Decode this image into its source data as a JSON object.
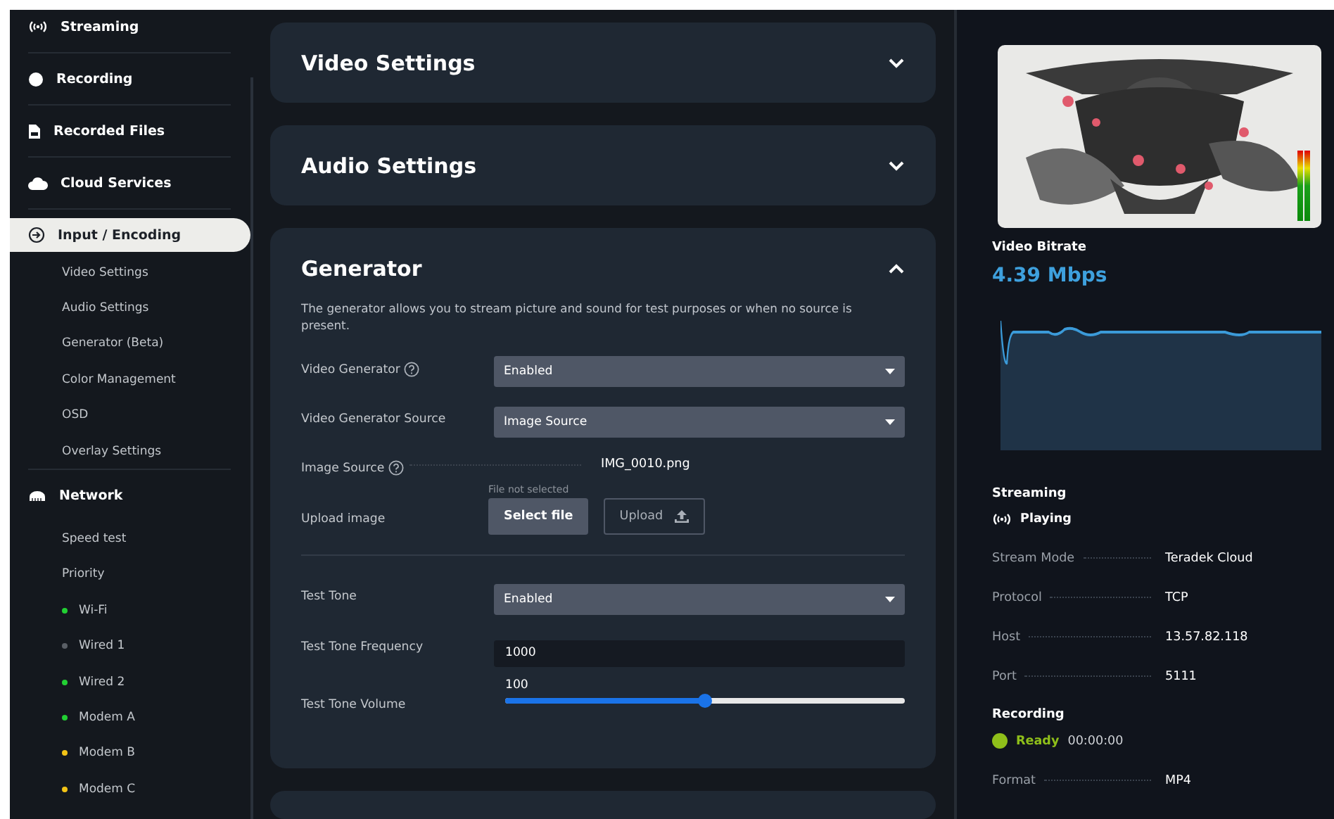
{
  "sidebar": {
    "items": [
      {
        "label": "Streaming",
        "selected": false
      },
      {
        "label": "Recording",
        "selected": false
      },
      {
        "label": "Recorded Files",
        "selected": false
      },
      {
        "label": "Cloud Services",
        "selected": false
      },
      {
        "label": "Input / Encoding",
        "selected": true,
        "children": [
          {
            "label": "Video Settings"
          },
          {
            "label": "Audio Settings"
          },
          {
            "label": "Generator (Beta)"
          },
          {
            "label": "Color Management"
          },
          {
            "label": "OSD"
          },
          {
            "label": "Overlay Settings"
          }
        ]
      },
      {
        "label": "Network",
        "selected": false,
        "children": [
          {
            "label": "Speed test"
          },
          {
            "label": "Priority"
          },
          {
            "label": "Wi-Fi",
            "color": "#22d033"
          },
          {
            "label": "Wired 1",
            "color": "#5a5f66"
          },
          {
            "label": "Wired 2",
            "color": "#22d033"
          },
          {
            "label": "Modem A",
            "color": "#22d033"
          },
          {
            "label": "Modem B",
            "color": "#f2c316"
          },
          {
            "label": "Modem C",
            "color": "#f2c316"
          }
        ]
      }
    ]
  },
  "cards": [
    {
      "title": "Video Settings",
      "expanded": false
    },
    {
      "title": "Audio Settings",
      "expanded": false
    },
    {
      "title": "Generator",
      "expanded": true,
      "description": "The generator allows you to stream picture and sound for test purposes or when no source is present.",
      "fields": [
        {
          "kind": "select",
          "label": "Video Generator",
          "help": true,
          "value": "Enabled"
        },
        {
          "kind": "select",
          "label": "Video Generator Source",
          "help": false,
          "value": "Image Source"
        },
        {
          "kind": "readout",
          "label": "Image Source",
          "help": true,
          "value": "IMG_0010.png"
        },
        {
          "kind": "file",
          "label": "Upload image",
          "help": false,
          "status": "File not selected",
          "select_button": "Select file",
          "upload_button": "Upload"
        },
        {
          "kind": "divider"
        },
        {
          "kind": "select",
          "label": "Test Tone",
          "help": false,
          "value": "Enabled"
        },
        {
          "kind": "input",
          "label": "Test Tone Frequency",
          "help": false,
          "value": "1000"
        },
        {
          "kind": "slider",
          "label": "Test Tone Volume",
          "help": false,
          "value": "100",
          "level": 0.5
        }
      ]
    }
  ],
  "preview": {
    "meters": [
      {
        "level": 0.97
      },
      {
        "level": 0.97
      }
    ]
  },
  "bitrate": {
    "label": "Video Bitrate",
    "value": "4.39 Mbps"
  },
  "streaming": {
    "title": "Streaming",
    "state": "Playing",
    "rows": [
      {
        "label": "Stream Mode",
        "value": "Teradek Cloud"
      },
      {
        "label": "Protocol",
        "value": "TCP"
      },
      {
        "label": "Host",
        "value": "13.57.82.118"
      },
      {
        "label": "Port",
        "value": "5111"
      }
    ]
  },
  "recording": {
    "title": "Recording",
    "state": "Ready",
    "time": "00:00:00",
    "rows": [
      {
        "label": "Format",
        "value": "MP4"
      }
    ]
  }
}
